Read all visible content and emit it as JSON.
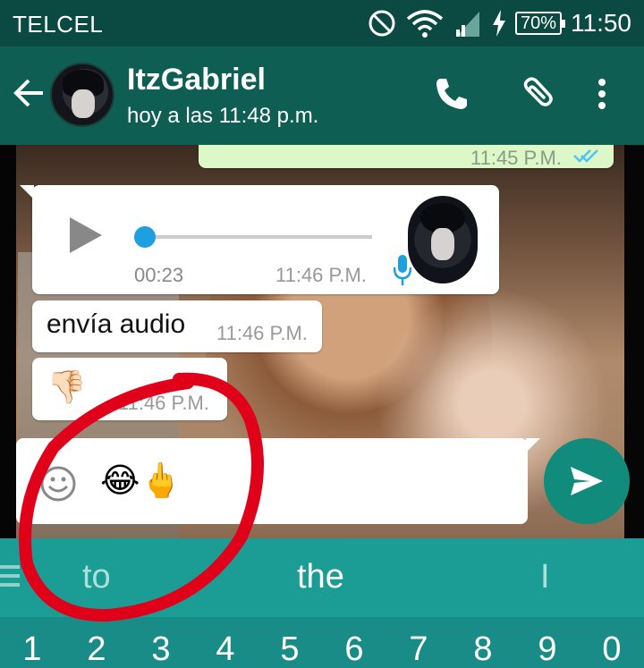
{
  "status_bar": {
    "carrier": "TELCEL",
    "battery": "70%",
    "time": "11:50"
  },
  "header": {
    "contact_name": "ItzGabriel",
    "last_seen": "hoy a las 11:48 p.m.",
    "icons": [
      "back-arrow-icon",
      "phone-icon",
      "paperclip-icon",
      "more-vert-icon"
    ]
  },
  "chat": {
    "partial_message_time": "11:45 P.M.",
    "audio_message": {
      "duration": "00:23",
      "time": "11:46 P.M."
    },
    "text_message": {
      "text": "envía audio",
      "time": "11:46 P.M."
    },
    "emoji_message": {
      "emoji": "👎🏻",
      "time": "11:46 P.M."
    }
  },
  "composer": {
    "text": "😂🖕"
  },
  "keyboard": {
    "suggestions": [
      "to",
      "the",
      "I"
    ],
    "numbers": [
      "1",
      "2",
      "3",
      "4",
      "5",
      "6",
      "7",
      "8",
      "9",
      "0"
    ]
  },
  "colors": {
    "header": "#0f5e53",
    "status_bar": "#0b4a42",
    "send_button": "#108b7c",
    "keyboard": "#1b9c95",
    "annotation": "#e0001a"
  }
}
